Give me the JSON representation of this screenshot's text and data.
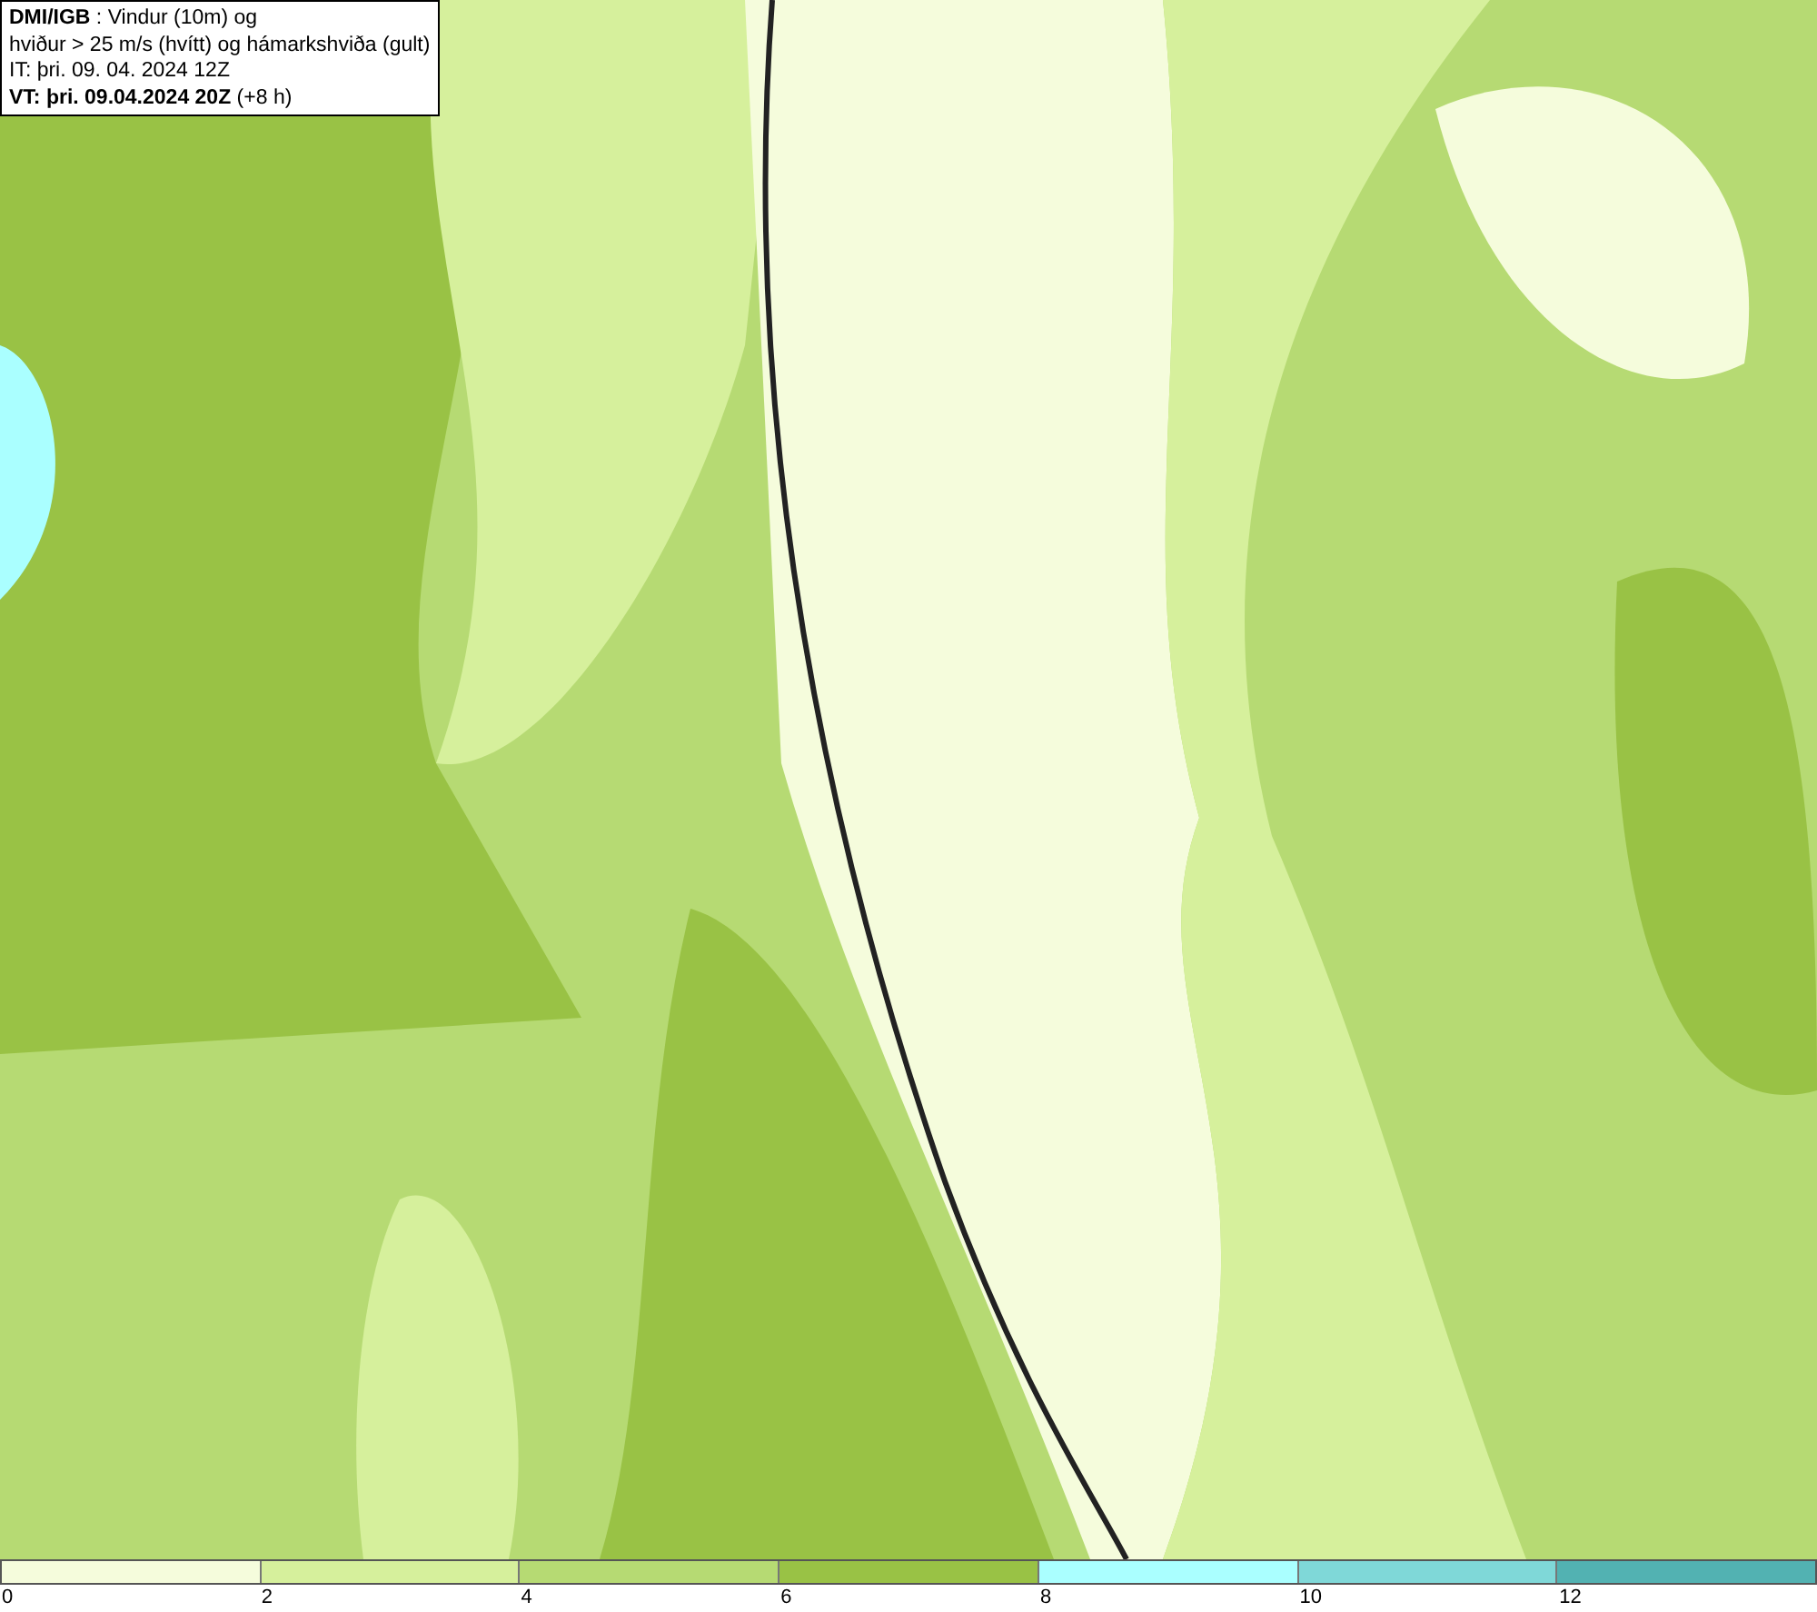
{
  "title_box": {
    "lines": [
      "**DMI/IGB** : Vindur (10m) og",
      "hviður > 25 m/s (hvítt) og hámarkshviða (gult)",
      "IT: þri. 09. 04. 2024 12Z",
      "**VT: þri. 09.04.2024 20Z** (+8 h)"
    ]
  },
  "legend": [
    {
      "color": "#f5fcdc",
      "label": "0"
    },
    {
      "color": "#d6f09c",
      "label": "2"
    },
    {
      "color": "#b6da73",
      "label": "4"
    },
    {
      "color": "#99c245",
      "label": "6"
    },
    {
      "color": "#aaffff",
      "label": "8"
    },
    {
      "color": "#7fd8d8",
      "label": "10"
    },
    {
      "color": "#52b2b2",
      "label": "12"
    }
  ]
}
